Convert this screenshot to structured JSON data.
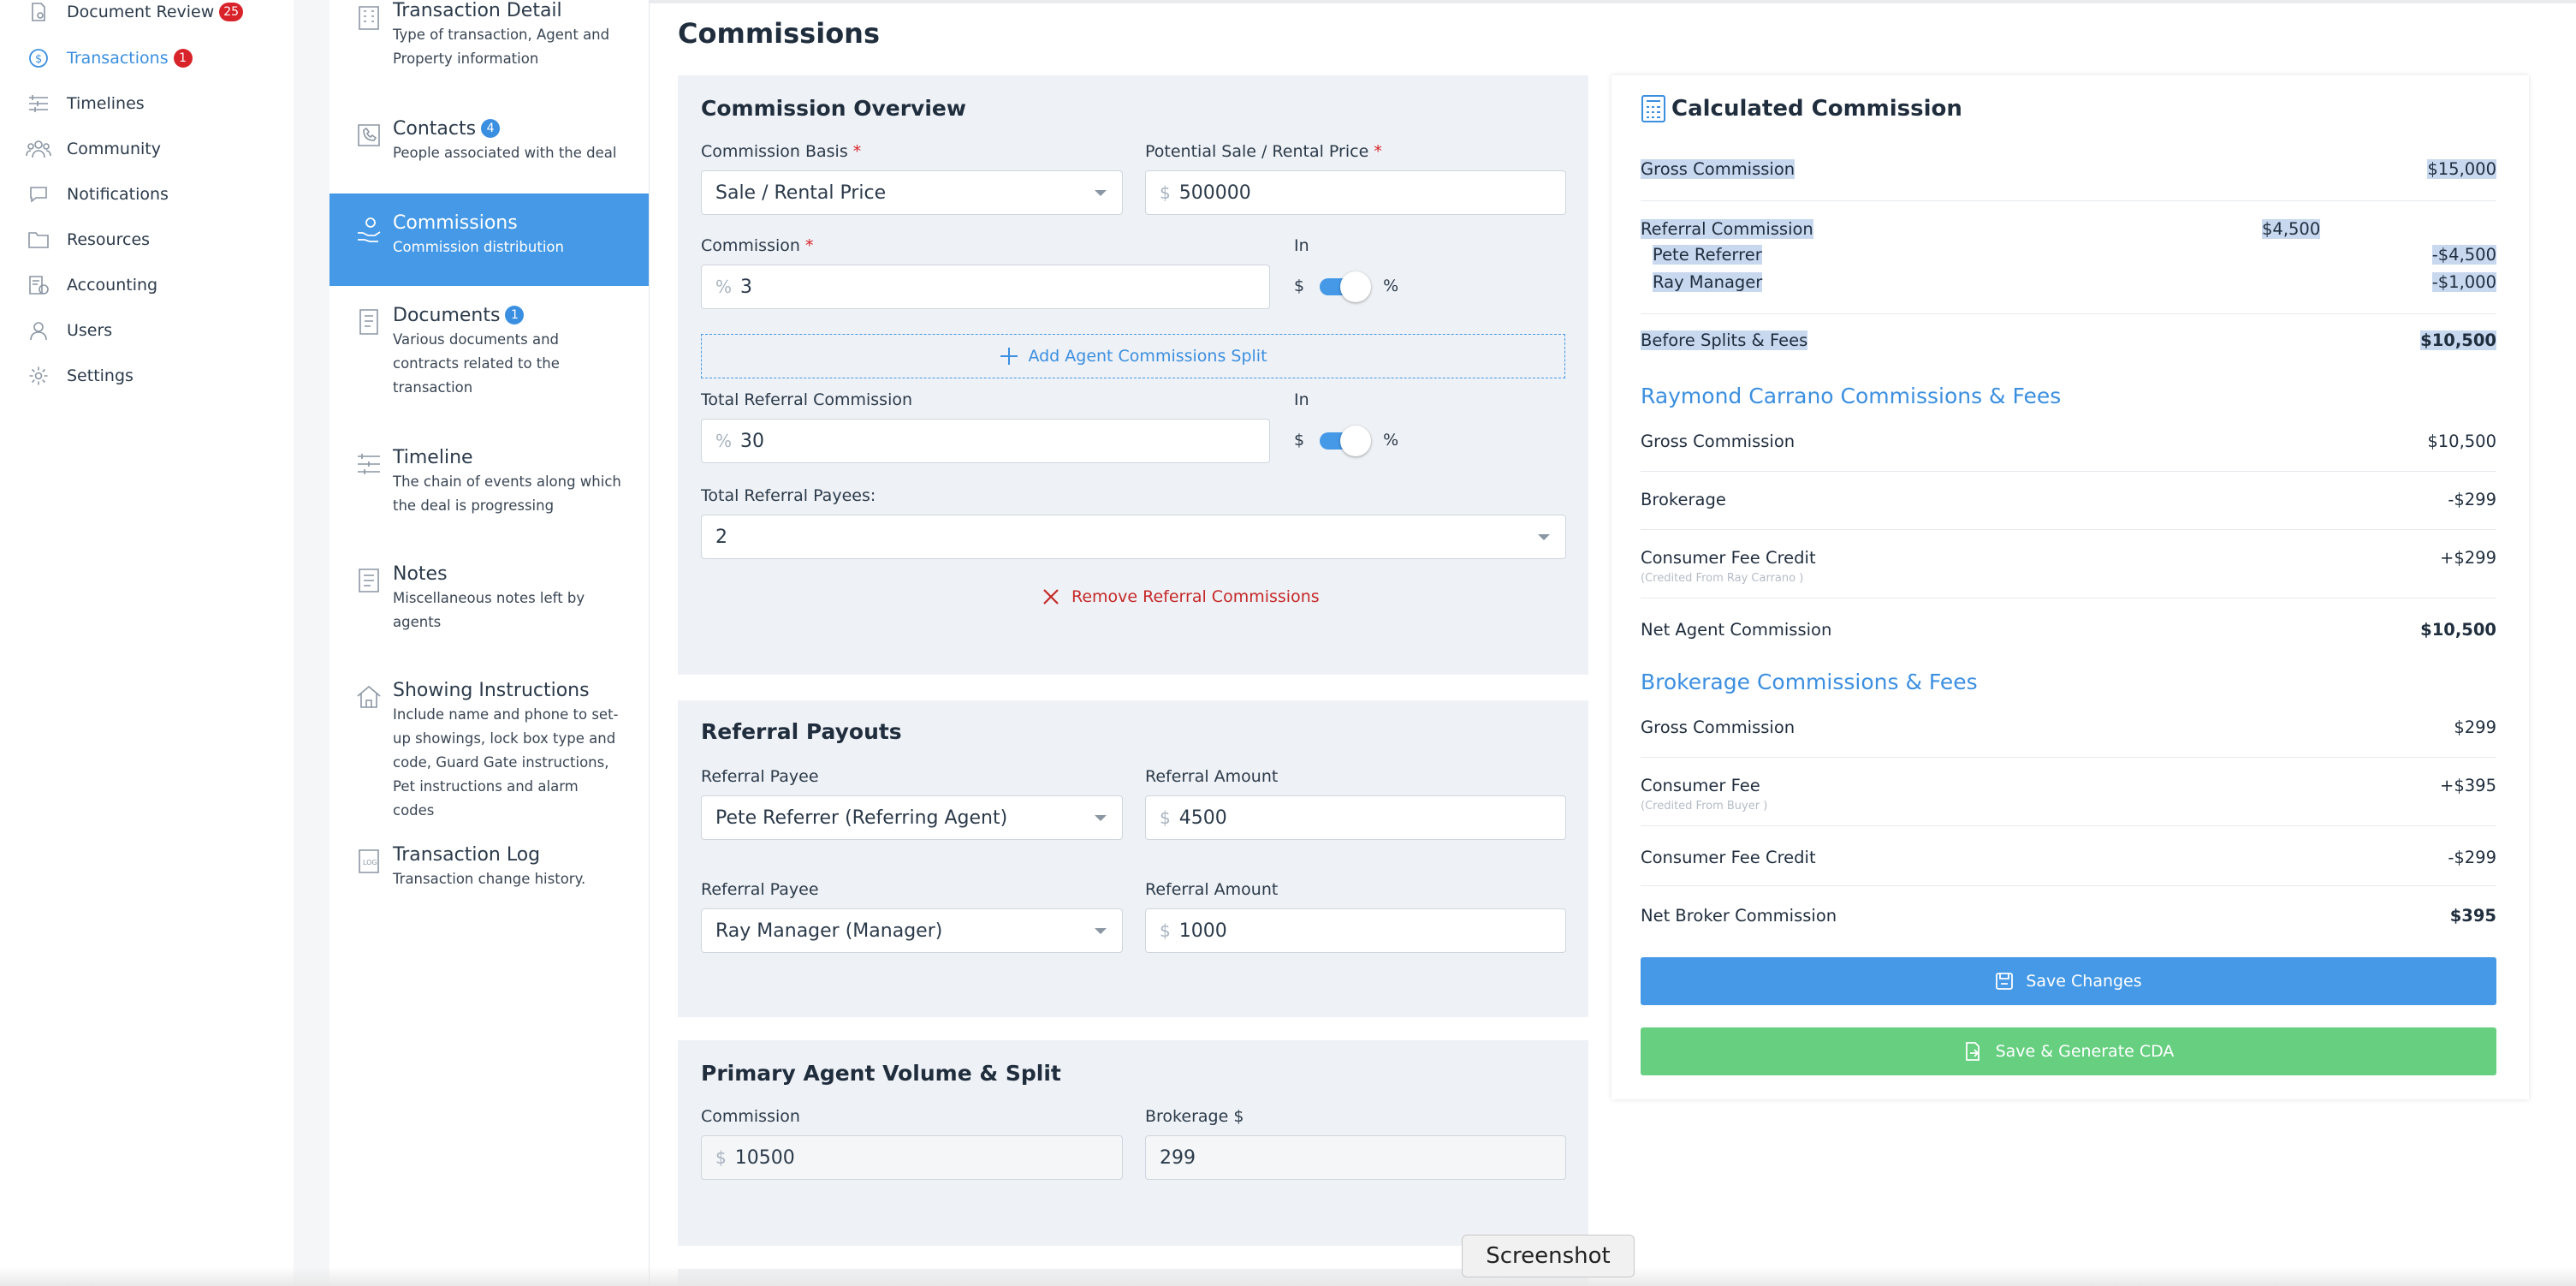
{
  "nav": {
    "items": [
      {
        "label": "Document Review",
        "badge": "25",
        "icon": "document-review-icon"
      },
      {
        "label": "Transactions",
        "badge": "1",
        "icon": "dollar-circle-icon"
      },
      {
        "label": "Timelines",
        "icon": "timeline-icon"
      },
      {
        "label": "Community",
        "icon": "community-icon"
      },
      {
        "label": "Notifications",
        "icon": "chat-bubble-icon"
      },
      {
        "label": "Resources",
        "icon": "folder-icon"
      },
      {
        "label": "Accounting",
        "icon": "accounting-icon"
      },
      {
        "label": "Users",
        "icon": "user-icon"
      },
      {
        "label": "Settings",
        "icon": "gear-icon"
      }
    ]
  },
  "steps": [
    {
      "title": "Transaction Detail",
      "desc": "Type of transaction, Agent and Property information"
    },
    {
      "title": "Contacts",
      "badge": "4",
      "desc": "People associated with the deal"
    },
    {
      "title": "Commissions",
      "desc": "Commission distribution"
    },
    {
      "title": "Documents",
      "badge": "1",
      "desc": "Various documents and contracts related to the transaction"
    },
    {
      "title": "Timeline",
      "desc": "The chain of events along which the deal is progressing"
    },
    {
      "title": "Notes",
      "desc": "Miscellaneous notes left by agents"
    },
    {
      "title": "Showing Instructions",
      "desc": "Include name and phone to set-up showings, lock box type and code, Guard Gate instructions, Pet instructions and alarm codes"
    },
    {
      "title": "Transaction Log",
      "desc": "Transaction change history."
    }
  ],
  "page": {
    "title": "Commissions"
  },
  "overview": {
    "title": "Commission Overview",
    "basis_label": "Commission Basis",
    "basis_value": "Sale / Rental Price",
    "price_label": "Potential Sale / Rental Price",
    "price_prefix": "$",
    "price_value": "500000",
    "commission_label": "Commission",
    "commission_prefix": "%",
    "commission_value": "3",
    "in_label": "In",
    "toggle_left": "$",
    "toggle_right": "%",
    "add_split_label": "Add Agent Commissions Split",
    "referral_label": "Total Referral Commission",
    "referral_prefix": "%",
    "referral_value": "30",
    "payees_label": "Total Referral Payees:",
    "payees_value": "2",
    "remove_label": "Remove Referral Commissions",
    "required_mark": "*"
  },
  "payouts": {
    "title": "Referral Payouts",
    "payee_label": "Referral Payee",
    "amount_label": "Referral Amount",
    "prefix": "$",
    "rows": [
      {
        "payee": "Pete Referrer (Referring Agent)",
        "amount": "4500"
      },
      {
        "payee": "Ray Manager (Manager)",
        "amount": "1000"
      }
    ]
  },
  "primary": {
    "title": "Primary Agent Volume & Split",
    "commission_label": "Commission",
    "commission_prefix": "$",
    "commission_value": "10500",
    "brokerage_label": "Brokerage $",
    "brokerage_value": "299"
  },
  "calc": {
    "title": "Calculated Commission",
    "gross_label": "Gross Commission",
    "gross_value": "$15,000",
    "referral_label": "Referral Commission",
    "referral_value": "$4,500",
    "pete_label": "Pete Referrer",
    "pete_value": "-$4,500",
    "ray_label": "Ray Manager",
    "ray_value": "-$1,000",
    "before_label": "Before Splits & Fees",
    "before_value": "$10,500",
    "agent_section": "Raymond Carrano Commissions & Fees",
    "agent_gross_label": "Gross Commission",
    "agent_gross_value": "$10,500",
    "agent_brokerage_label": "Brokerage",
    "agent_brokerage_value": "-$299",
    "agent_credit_label": "Consumer Fee Credit",
    "agent_credit_note": "(Credited From Ray Carrano )",
    "agent_credit_value": "+$299",
    "agent_net_label": "Net Agent Commission",
    "agent_net_value": "$10,500",
    "broker_section": "Brokerage Commissions & Fees",
    "broker_gross_label": "Gross Commission",
    "broker_gross_value": "$299",
    "broker_fee_label": "Consumer Fee",
    "broker_fee_note": "(Credited From Buyer )",
    "broker_fee_value": "+$395",
    "broker_credit_label": "Consumer Fee Credit",
    "broker_credit_value": "-$299",
    "broker_net_label": "Net Broker Commission",
    "broker_net_value": "$395",
    "save_label": "Save Changes",
    "generate_label": "Save & Generate CDA"
  },
  "tooltip": {
    "label": "Screenshot"
  },
  "colors": {
    "accent": "#4599e6",
    "danger": "#d8232a",
    "success": "#66cf80"
  }
}
